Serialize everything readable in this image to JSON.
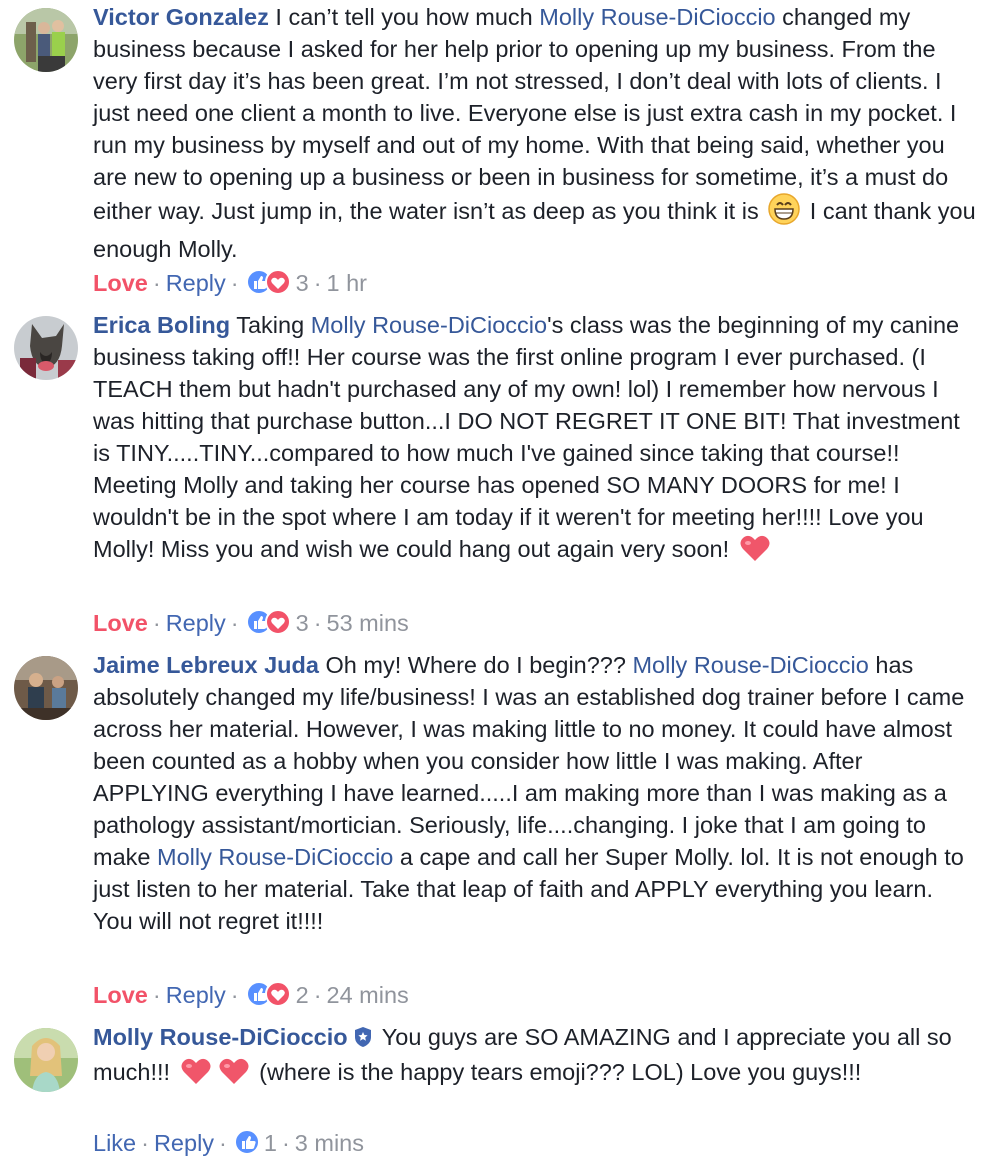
{
  "comments": [
    {
      "author": "Victor Gonzalez",
      "seg1": " I can’t tell you how much ",
      "mention1": "Molly Rouse-DiCioccio",
      "seg2": " changed my business because I asked for her help prior to opening up my business. From the very first day it’s has been great. I’m not stressed, I don’t deal with lots of clients. I just need one client a month to live. Everyone else is just extra cash in my pocket. I run my business by myself and out of my home. With that being said, whether you are new to opening up a business or been in business for sometime, it’s a must do either way. Just jump in, the water isn’t as deep as you think it is ",
      "seg3": " I cant thank you enough Molly.",
      "emoji": "grinning-face-icon",
      "action_primary": "Love",
      "reply": "Reply",
      "reaction_count": "3",
      "time": "1 hr"
    },
    {
      "author": "Erica Boling",
      "seg1": " Taking ",
      "mention1": "Molly Rouse-DiCioccio",
      "seg2": "'s class was the beginning of my canine business taking off!! Her course was the first online program I ever purchased. (I TEACH them but hadn't purchased any of my own! lol) I remember how nervous I was hitting that purchase button...I DO NOT REGRET IT ONE BIT! That investment is TINY.....TINY...compared to how much I've gained since taking that course!! Meeting Molly and taking her course has opened SO MANY DOORS for me! I wouldn't be in the spot where I am today if it weren't for meeting her!!!! Love you Molly! Miss you and wish we could hang out again very soon! ",
      "emoji": "heart-icon",
      "action_primary": "Love",
      "reply": "Reply",
      "reaction_count": "3",
      "time": "53 mins"
    },
    {
      "author": "Jaime Lebreux Juda",
      "seg1": " Oh my! Where do I begin??? ",
      "mention1": "Molly Rouse-DiCioccio",
      "seg2": " has absolutely changed my life/business! I was an established dog trainer before I came across her material. However, I was making little to no money. It could have almost been counted as a hobby when you consider how little I was making. After APPLYING everything I have learned.....I am making more than I was making as a pathology assistant/mortician. Seriously, life....changing. I joke that I am going to make ",
      "mention2": "Molly Rouse-DiCioccio",
      "seg3": " a cape and call her Super Molly. lol. It is not enough to just listen to her material. Take that leap of faith and APPLY everything you learn. You will not regret it!!!!",
      "action_primary": "Love",
      "reply": "Reply",
      "reaction_count": "2",
      "time": "24 mins"
    },
    {
      "author": "Molly Rouse-DiCioccio",
      "verified_icon": "verified-shield-icon",
      "seg1": " You guys are SO AMAZING and I appreciate you all so much!!! ",
      "seg2": " (where is the happy tears emoji??? LOL) Love you guys!!!",
      "emoji": "heart-icon",
      "action_primary": "Like",
      "reply": "Reply",
      "reaction_count": "1",
      "time": "3 mins"
    }
  ],
  "separator": "·",
  "colors": {
    "link": "#365899",
    "love": "#f25268",
    "like": "#4267b2",
    "meta": "#90949c",
    "text": "#1d2129"
  }
}
